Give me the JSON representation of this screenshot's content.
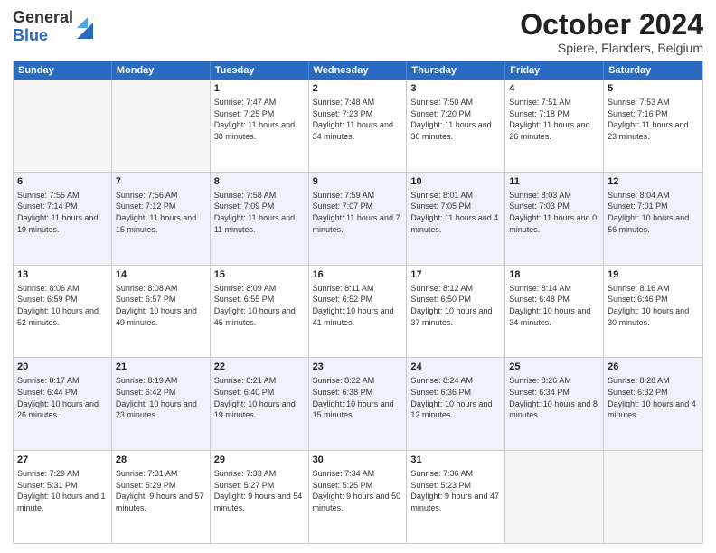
{
  "logo": {
    "general": "General",
    "blue": "Blue"
  },
  "title": "October 2024",
  "subtitle": "Spiere, Flanders, Belgium",
  "days": [
    "Sunday",
    "Monday",
    "Tuesday",
    "Wednesday",
    "Thursday",
    "Friday",
    "Saturday"
  ],
  "rows": [
    [
      {
        "day": "",
        "empty": true
      },
      {
        "day": "",
        "empty": true
      },
      {
        "day": "1",
        "sunrise": "Sunrise: 7:47 AM",
        "sunset": "Sunset: 7:25 PM",
        "daylight": "Daylight: 11 hours and 38 minutes."
      },
      {
        "day": "2",
        "sunrise": "Sunrise: 7:48 AM",
        "sunset": "Sunset: 7:23 PM",
        "daylight": "Daylight: 11 hours and 34 minutes."
      },
      {
        "day": "3",
        "sunrise": "Sunrise: 7:50 AM",
        "sunset": "Sunset: 7:20 PM",
        "daylight": "Daylight: 11 hours and 30 minutes."
      },
      {
        "day": "4",
        "sunrise": "Sunrise: 7:51 AM",
        "sunset": "Sunset: 7:18 PM",
        "daylight": "Daylight: 11 hours and 26 minutes."
      },
      {
        "day": "5",
        "sunrise": "Sunrise: 7:53 AM",
        "sunset": "Sunset: 7:16 PM",
        "daylight": "Daylight: 11 hours and 23 minutes."
      }
    ],
    [
      {
        "day": "6",
        "sunrise": "Sunrise: 7:55 AM",
        "sunset": "Sunset: 7:14 PM",
        "daylight": "Daylight: 11 hours and 19 minutes."
      },
      {
        "day": "7",
        "sunrise": "Sunrise: 7:56 AM",
        "sunset": "Sunset: 7:12 PM",
        "daylight": "Daylight: 11 hours and 15 minutes."
      },
      {
        "day": "8",
        "sunrise": "Sunrise: 7:58 AM",
        "sunset": "Sunset: 7:09 PM",
        "daylight": "Daylight: 11 hours and 11 minutes."
      },
      {
        "day": "9",
        "sunrise": "Sunrise: 7:59 AM",
        "sunset": "Sunset: 7:07 PM",
        "daylight": "Daylight: 11 hours and 7 minutes."
      },
      {
        "day": "10",
        "sunrise": "Sunrise: 8:01 AM",
        "sunset": "Sunset: 7:05 PM",
        "daylight": "Daylight: 11 hours and 4 minutes."
      },
      {
        "day": "11",
        "sunrise": "Sunrise: 8:03 AM",
        "sunset": "Sunset: 7:03 PM",
        "daylight": "Daylight: 11 hours and 0 minutes."
      },
      {
        "day": "12",
        "sunrise": "Sunrise: 8:04 AM",
        "sunset": "Sunset: 7:01 PM",
        "daylight": "Daylight: 10 hours and 56 minutes."
      }
    ],
    [
      {
        "day": "13",
        "sunrise": "Sunrise: 8:06 AM",
        "sunset": "Sunset: 6:59 PM",
        "daylight": "Daylight: 10 hours and 52 minutes."
      },
      {
        "day": "14",
        "sunrise": "Sunrise: 8:08 AM",
        "sunset": "Sunset: 6:57 PM",
        "daylight": "Daylight: 10 hours and 49 minutes."
      },
      {
        "day": "15",
        "sunrise": "Sunrise: 8:09 AM",
        "sunset": "Sunset: 6:55 PM",
        "daylight": "Daylight: 10 hours and 45 minutes."
      },
      {
        "day": "16",
        "sunrise": "Sunrise: 8:11 AM",
        "sunset": "Sunset: 6:52 PM",
        "daylight": "Daylight: 10 hours and 41 minutes."
      },
      {
        "day": "17",
        "sunrise": "Sunrise: 8:12 AM",
        "sunset": "Sunset: 6:50 PM",
        "daylight": "Daylight: 10 hours and 37 minutes."
      },
      {
        "day": "18",
        "sunrise": "Sunrise: 8:14 AM",
        "sunset": "Sunset: 6:48 PM",
        "daylight": "Daylight: 10 hours and 34 minutes."
      },
      {
        "day": "19",
        "sunrise": "Sunrise: 8:16 AM",
        "sunset": "Sunset: 6:46 PM",
        "daylight": "Daylight: 10 hours and 30 minutes."
      }
    ],
    [
      {
        "day": "20",
        "sunrise": "Sunrise: 8:17 AM",
        "sunset": "Sunset: 6:44 PM",
        "daylight": "Daylight: 10 hours and 26 minutes."
      },
      {
        "day": "21",
        "sunrise": "Sunrise: 8:19 AM",
        "sunset": "Sunset: 6:42 PM",
        "daylight": "Daylight: 10 hours and 23 minutes."
      },
      {
        "day": "22",
        "sunrise": "Sunrise: 8:21 AM",
        "sunset": "Sunset: 6:40 PM",
        "daylight": "Daylight: 10 hours and 19 minutes."
      },
      {
        "day": "23",
        "sunrise": "Sunrise: 8:22 AM",
        "sunset": "Sunset: 6:38 PM",
        "daylight": "Daylight: 10 hours and 15 minutes."
      },
      {
        "day": "24",
        "sunrise": "Sunrise: 8:24 AM",
        "sunset": "Sunset: 6:36 PM",
        "daylight": "Daylight: 10 hours and 12 minutes."
      },
      {
        "day": "25",
        "sunrise": "Sunrise: 8:26 AM",
        "sunset": "Sunset: 6:34 PM",
        "daylight": "Daylight: 10 hours and 8 minutes."
      },
      {
        "day": "26",
        "sunrise": "Sunrise: 8:28 AM",
        "sunset": "Sunset: 6:32 PM",
        "daylight": "Daylight: 10 hours and 4 minutes."
      }
    ],
    [
      {
        "day": "27",
        "sunrise": "Sunrise: 7:29 AM",
        "sunset": "Sunset: 5:31 PM",
        "daylight": "Daylight: 10 hours and 1 minute."
      },
      {
        "day": "28",
        "sunrise": "Sunrise: 7:31 AM",
        "sunset": "Sunset: 5:29 PM",
        "daylight": "Daylight: 9 hours and 57 minutes."
      },
      {
        "day": "29",
        "sunrise": "Sunrise: 7:33 AM",
        "sunset": "Sunset: 5:27 PM",
        "daylight": "Daylight: 9 hours and 54 minutes."
      },
      {
        "day": "30",
        "sunrise": "Sunrise: 7:34 AM",
        "sunset": "Sunset: 5:25 PM",
        "daylight": "Daylight: 9 hours and 50 minutes."
      },
      {
        "day": "31",
        "sunrise": "Sunrise: 7:36 AM",
        "sunset": "Sunset: 5:23 PM",
        "daylight": "Daylight: 9 hours and 47 minutes."
      },
      {
        "day": "",
        "empty": true
      },
      {
        "day": "",
        "empty": true
      }
    ]
  ]
}
